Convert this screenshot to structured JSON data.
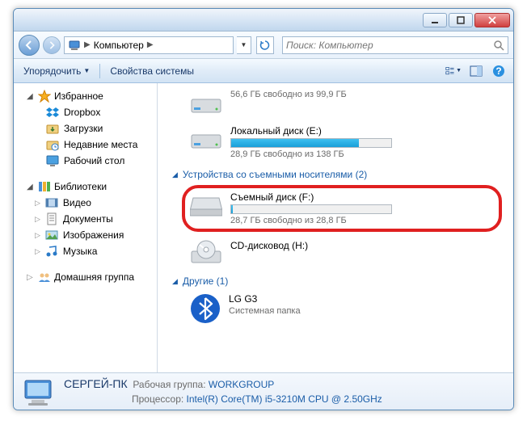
{
  "breadcrumb": {
    "location": "Компьютер"
  },
  "search": {
    "placeholder": "Поиск: Компьютер"
  },
  "toolbar": {
    "organize": "Упорядочить",
    "properties": "Свойства системы"
  },
  "sidebar": {
    "favorites": {
      "label": "Избранное",
      "items": [
        "Dropbox",
        "Загрузки",
        "Недавние места",
        "Рабочий стол"
      ]
    },
    "libraries": {
      "label": "Библиотеки",
      "items": [
        "Видео",
        "Документы",
        "Изображения",
        "Музыка"
      ]
    },
    "homegroup": {
      "label": "Домашняя группа"
    }
  },
  "drives": {
    "partial_free": "56,6 ГБ свободно из 99,9 ГБ",
    "local_e": {
      "name": "Локальный диск (E:)",
      "free": "28,9 ГБ свободно из 138 ГБ",
      "fill_pct": 80
    }
  },
  "removable_group": {
    "label": "Устройства со съемными носителями (2)",
    "f": {
      "name": "Съемный диск (F:)",
      "free": "28,7 ГБ свободно из 28,8 ГБ",
      "fill_pct": 1
    },
    "cd": {
      "name": "CD-дисковод (H:)"
    }
  },
  "other_group": {
    "label": "Другие (1)",
    "lg": {
      "name": "LG G3",
      "sub": "Системная папка"
    }
  },
  "status": {
    "hostname": "СЕРГЕЙ-ПК",
    "workgroup_label": "Рабочая группа:",
    "workgroup": "WORKGROUP",
    "cpu_label": "Процессор:",
    "cpu": "Intel(R) Core(TM) i5-3210M CPU @ 2.50GHz"
  }
}
